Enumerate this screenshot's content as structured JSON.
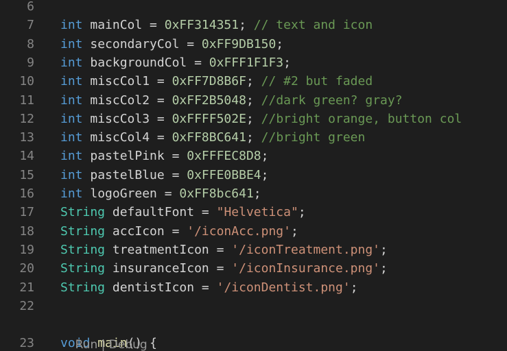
{
  "lines": [
    {
      "num": "6",
      "tokens": []
    },
    {
      "num": "7",
      "tokens": [
        [
          "int",
          "type"
        ],
        [
          " ",
          "var"
        ],
        [
          "mainCol",
          "var"
        ],
        [
          " = ",
          "op"
        ],
        [
          "0xFF314351",
          "num"
        ],
        [
          ";",
          "punc"
        ],
        [
          " ",
          "var"
        ],
        [
          "// text and icon",
          "cmt"
        ]
      ]
    },
    {
      "num": "8",
      "tokens": [
        [
          "int",
          "type"
        ],
        [
          " ",
          "var"
        ],
        [
          "secondaryCol",
          "var"
        ],
        [
          " = ",
          "op"
        ],
        [
          "0xFF9DB150",
          "num"
        ],
        [
          ";",
          "punc"
        ]
      ]
    },
    {
      "num": "9",
      "tokens": [
        [
          "int",
          "type"
        ],
        [
          " ",
          "var"
        ],
        [
          "backgroundCol",
          "var"
        ],
        [
          " = ",
          "op"
        ],
        [
          "0xFFF1F1F3",
          "num"
        ],
        [
          ";",
          "punc"
        ]
      ]
    },
    {
      "num": "10",
      "tokens": [
        [
          "int",
          "type"
        ],
        [
          " ",
          "var"
        ],
        [
          "miscCol1",
          "var"
        ],
        [
          " = ",
          "op"
        ],
        [
          "0xFF7D8B6F",
          "num"
        ],
        [
          ";",
          "punc"
        ],
        [
          " ",
          "var"
        ],
        [
          "// #2 but faded",
          "cmt"
        ]
      ]
    },
    {
      "num": "11",
      "tokens": [
        [
          "int",
          "type"
        ],
        [
          " ",
          "var"
        ],
        [
          "miscCol2",
          "var"
        ],
        [
          " = ",
          "op"
        ],
        [
          "0xFF2B5048",
          "num"
        ],
        [
          ";",
          "punc"
        ],
        [
          " ",
          "var"
        ],
        [
          "//dark green? gray?",
          "cmt"
        ]
      ]
    },
    {
      "num": "12",
      "tokens": [
        [
          "int",
          "type"
        ],
        [
          " ",
          "var"
        ],
        [
          "miscCol3",
          "var"
        ],
        [
          " = ",
          "op"
        ],
        [
          "0xFFFF502E",
          "num"
        ],
        [
          ";",
          "punc"
        ],
        [
          " ",
          "var"
        ],
        [
          "//bright orange, button col",
          "cmt"
        ]
      ]
    },
    {
      "num": "13",
      "tokens": [
        [
          "int",
          "type"
        ],
        [
          " ",
          "var"
        ],
        [
          "miscCol4",
          "var"
        ],
        [
          " = ",
          "op"
        ],
        [
          "0xFF8BC641",
          "num"
        ],
        [
          ";",
          "punc"
        ],
        [
          " ",
          "var"
        ],
        [
          "//bright green",
          "cmt"
        ]
      ]
    },
    {
      "num": "14",
      "tokens": [
        [
          "int",
          "type"
        ],
        [
          " ",
          "var"
        ],
        [
          "pastelPink",
          "var"
        ],
        [
          " = ",
          "op"
        ],
        [
          "0xFFFEC8D8",
          "num"
        ],
        [
          ";",
          "punc"
        ]
      ]
    },
    {
      "num": "15",
      "tokens": [
        [
          "int",
          "type"
        ],
        [
          " ",
          "var"
        ],
        [
          "pastelBlue",
          "var"
        ],
        [
          " = ",
          "op"
        ],
        [
          "0xFFE0BBE4",
          "num"
        ],
        [
          ";",
          "punc"
        ]
      ]
    },
    {
      "num": "16",
      "tokens": [
        [
          "int",
          "type"
        ],
        [
          " ",
          "var"
        ],
        [
          "logoGreen",
          "var"
        ],
        [
          " = ",
          "op"
        ],
        [
          "0xFF8bc641",
          "num"
        ],
        [
          ";",
          "punc"
        ]
      ]
    },
    {
      "num": "17",
      "tokens": [
        [
          "String",
          "class"
        ],
        [
          " ",
          "var"
        ],
        [
          "defaultFont",
          "var"
        ],
        [
          " = ",
          "op"
        ],
        [
          "\"Helvetica\"",
          "str"
        ],
        [
          ";",
          "punc"
        ]
      ]
    },
    {
      "num": "18",
      "tokens": [
        [
          "String",
          "class"
        ],
        [
          " ",
          "var"
        ],
        [
          "accIcon",
          "var"
        ],
        [
          " = ",
          "op"
        ],
        [
          "'/iconAcc.png'",
          "str"
        ],
        [
          ";",
          "punc"
        ]
      ]
    },
    {
      "num": "19",
      "tokens": [
        [
          "String",
          "class"
        ],
        [
          " ",
          "var"
        ],
        [
          "treatmentIcon",
          "var"
        ],
        [
          " = ",
          "op"
        ],
        [
          "'/iconTreatment.png'",
          "str"
        ],
        [
          ";",
          "punc"
        ]
      ]
    },
    {
      "num": "20",
      "tokens": [
        [
          "String",
          "class"
        ],
        [
          " ",
          "var"
        ],
        [
          "insuranceIcon",
          "var"
        ],
        [
          " = ",
          "op"
        ],
        [
          "'/iconInsurance.png'",
          "str"
        ],
        [
          ";",
          "punc"
        ]
      ]
    },
    {
      "num": "21",
      "tokens": [
        [
          "String",
          "class"
        ],
        [
          " ",
          "var"
        ],
        [
          "dentistIcon",
          "var"
        ],
        [
          " = ",
          "op"
        ],
        [
          "'/iconDentist.png'",
          "str"
        ],
        [
          ";",
          "punc"
        ]
      ]
    },
    {
      "num": "22",
      "tokens": []
    },
    {
      "num": "23",
      "tokens": [
        [
          "void",
          "type"
        ],
        [
          " ",
          "var"
        ],
        [
          "main",
          "func"
        ],
        [
          "() {",
          "punc"
        ]
      ]
    }
  ],
  "codelens": {
    "run": "Run",
    "separator": " | ",
    "debug": "Debug"
  },
  "colors": {
    "background": "#1e1e1e",
    "line_number": "#858585",
    "keyword": "#569cd6",
    "class": "#4ec9b0",
    "variable": "#d4d4d4",
    "number": "#b5cea8",
    "comment": "#6a9955",
    "string": "#ce9178",
    "function": "#dcdcaa",
    "codelens": "#999999"
  }
}
